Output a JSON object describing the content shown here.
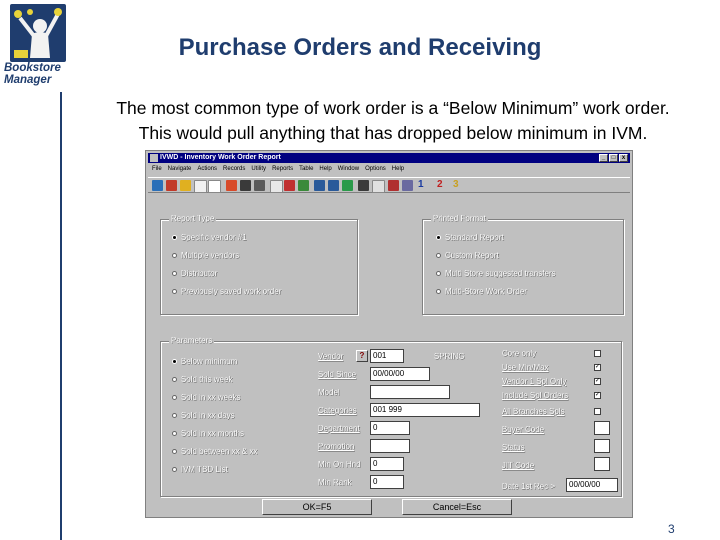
{
  "slide": {
    "title": "Purchase Orders and Receiving",
    "subtitle_line1": "The most common type of work order is a “Below Minimum” work order.",
    "subtitle_line2": "This would pull anything that has dropped below minimum in IVM.",
    "page_number": "3"
  },
  "logo": {
    "line1": "Bookstore",
    "line2": "Manager"
  },
  "window": {
    "title": "IVWD - Inventory Work Order Report",
    "menu": [
      "File",
      "Navigate",
      "Actions",
      "Records",
      "Utility",
      "Reports",
      "Table",
      "Help",
      "Window",
      "Options",
      "Help"
    ],
    "toolbar_numbers": [
      "1",
      "2",
      "3"
    ]
  },
  "report_type": {
    "legend": "Report Type",
    "options": [
      "Specific vendor #1",
      "Multiple vendors",
      "Distributor",
      "Previously saved work order"
    ],
    "selected": 0
  },
  "printed_format": {
    "legend": "Printed Format",
    "options": [
      "Standard Report",
      "Custom Report",
      "Multi Store suggested transfers",
      "Multi-Store Work Order"
    ],
    "selected": 0
  },
  "parameters": {
    "legend": "Parameters",
    "options": [
      "Below minimum",
      "Sold this week",
      "Sold in xx weeks",
      "Sold in xx days",
      "Sold in xx months",
      "Sold between xx & xx",
      "IVM TBD List"
    ],
    "selected": 0,
    "vendor_label": "Vendor",
    "vendor_value": "001",
    "vendor_name": "SPRING",
    "sold_since_label": "Sold Since",
    "sold_since_value": "00/00/00",
    "model_label": "Model",
    "categories_label": "Categories",
    "categories_value": "001 999",
    "department_label": "Department",
    "department_value": "0",
    "promotion_label": "Promotion",
    "min_onhand_label": "Min On Hnd",
    "min_onhand_value": "0",
    "min_rank_label": "Min Rank",
    "min_rank_value": "0",
    "checks": [
      {
        "label": "Core only",
        "checked": false
      },
      {
        "label": "Use Min/Max",
        "checked": true
      },
      {
        "label": "Vendor 1 Spl Only",
        "checked": true
      },
      {
        "label": "Include Spl Orders",
        "checked": true
      },
      {
        "label": "All Branches Spls",
        "checked": false
      }
    ],
    "buyer_code_label": "Buyer Code",
    "status_label": "Status",
    "jit_code_label": "JIT Code",
    "date_label": "Date 1st Rec >",
    "date_value": "00/00/00"
  },
  "buttons": {
    "ok": "OK=F5",
    "cancel": "Cancel=Esc"
  }
}
